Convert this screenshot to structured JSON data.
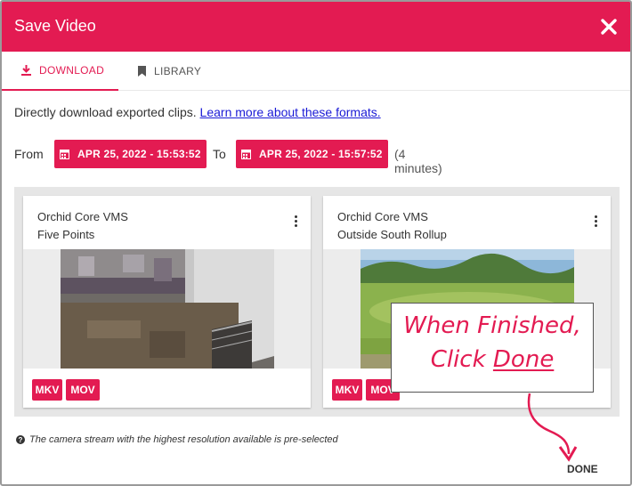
{
  "dialog": {
    "title": "Save Video",
    "close_icon": "close-icon",
    "accent_color": "#e31b52"
  },
  "tabs": [
    {
      "label": "DOWNLOAD",
      "icon": "download-icon",
      "active": true
    },
    {
      "label": "LIBRARY",
      "icon": "bookmark-icon",
      "active": false
    }
  ],
  "description": {
    "text": "Directly download exported clips.",
    "link": "Learn more about these formats."
  },
  "range": {
    "from_label": "From",
    "from_value": "APR 25, 2022 - 15:53:52",
    "to_label": "To",
    "to_value": "APR 25, 2022 - 15:57:52",
    "duration": "(4 minutes)",
    "date_icon": "calendar-icon"
  },
  "cameras": [
    {
      "server": "Orchid Core VMS",
      "name": "Five Points",
      "formats": [
        "MKV",
        "MOV"
      ],
      "menu_icon": "more-vertical-icon"
    },
    {
      "server": "Orchid Core VMS",
      "name": "Outside South Rollup",
      "formats": [
        "MKV",
        "MOV"
      ],
      "menu_icon": "more-vertical-icon"
    }
  ],
  "callout": {
    "line1": "When Finished,",
    "line2_prefix": "Click ",
    "line2_link": "Done"
  },
  "footnote": {
    "icon": "help-icon",
    "text": "The camera stream with the highest resolution available is pre-selected"
  },
  "actions": {
    "done_label": "DONE"
  }
}
